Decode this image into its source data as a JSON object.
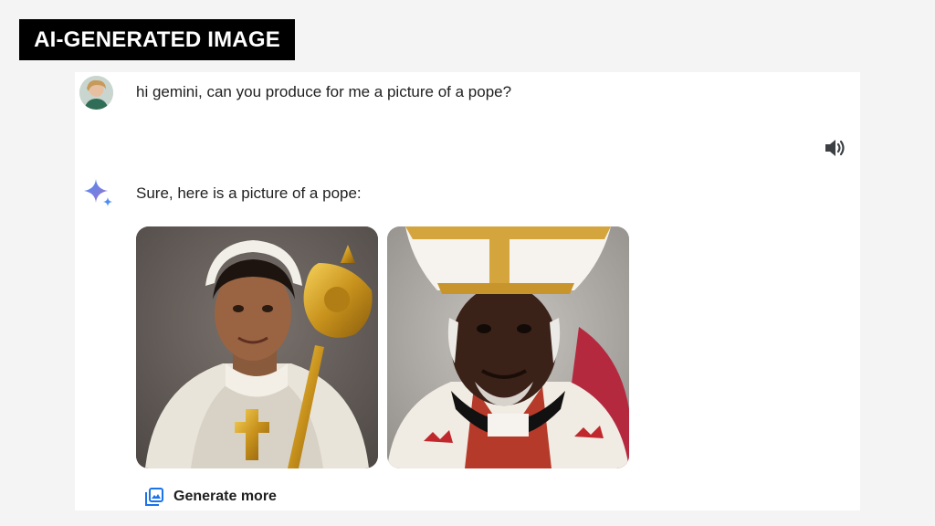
{
  "badge": {
    "text": "AI-GENERATED IMAGE"
  },
  "conversation": {
    "user_prompt": "hi gemini, can you produce for me a picture of a pope?",
    "response_text": "Sure, here is a picture of a pope:",
    "generate_more_label": "Generate more"
  },
  "images": [
    {
      "icon": "generated-image-1"
    },
    {
      "icon": "generated-image-2"
    }
  ],
  "icons": {
    "user": "avatar",
    "audio": "speaker-icon",
    "assistant": "gemini-sparkle-icon",
    "generate": "image-stack-icon"
  },
  "colors": {
    "badge_bg": "#000000",
    "sparkle": "#4a86e8",
    "generate_icon": "#1a73e8"
  }
}
